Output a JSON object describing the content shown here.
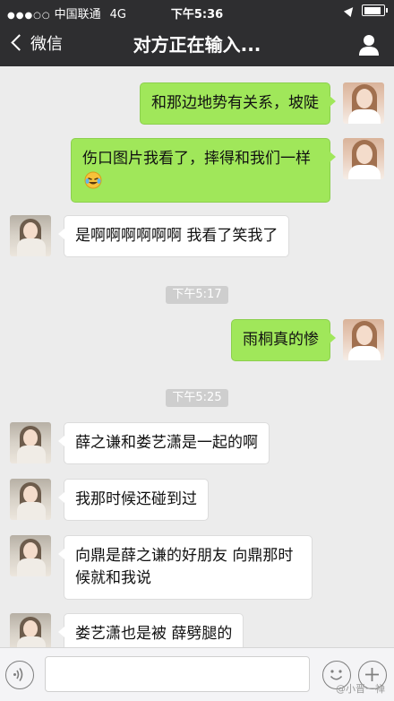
{
  "status_bar": {
    "signal": "●●●○○",
    "carrier": "中国联通",
    "network": "4G",
    "time": "下午5:36"
  },
  "nav": {
    "back_label": "微信",
    "title": "对方正在输入..."
  },
  "messages": [
    {
      "from": "me",
      "text": "和那边地势有关系，坡陡"
    },
    {
      "from": "me",
      "text": "伤口图片我看了，摔得和我们一样",
      "emoji": "crying-laughing-emoji"
    },
    {
      "from": "other",
      "text": "是啊啊啊啊啊啊 我看了笑我了"
    },
    {
      "type": "time",
      "text": "下午5:17"
    },
    {
      "from": "me",
      "text": "雨桐真的惨"
    },
    {
      "type": "time",
      "text": "下午5:25"
    },
    {
      "from": "other",
      "text": "薛之谦和娄艺潇是一起的啊"
    },
    {
      "from": "other",
      "text": "我那时候还碰到过"
    },
    {
      "from": "other",
      "text": "向鼎是薛之谦的好朋友 向鼎那时候就和我说"
    },
    {
      "from": "other",
      "text": "娄艺潇也是被  薛劈腿的"
    }
  ],
  "watermark": "@小晋一禅",
  "colors": {
    "bar_bg": "#2e2e30",
    "bubble_out": "#a0e75a",
    "bubble_in": "#ffffff",
    "chat_bg": "#ececec"
  }
}
